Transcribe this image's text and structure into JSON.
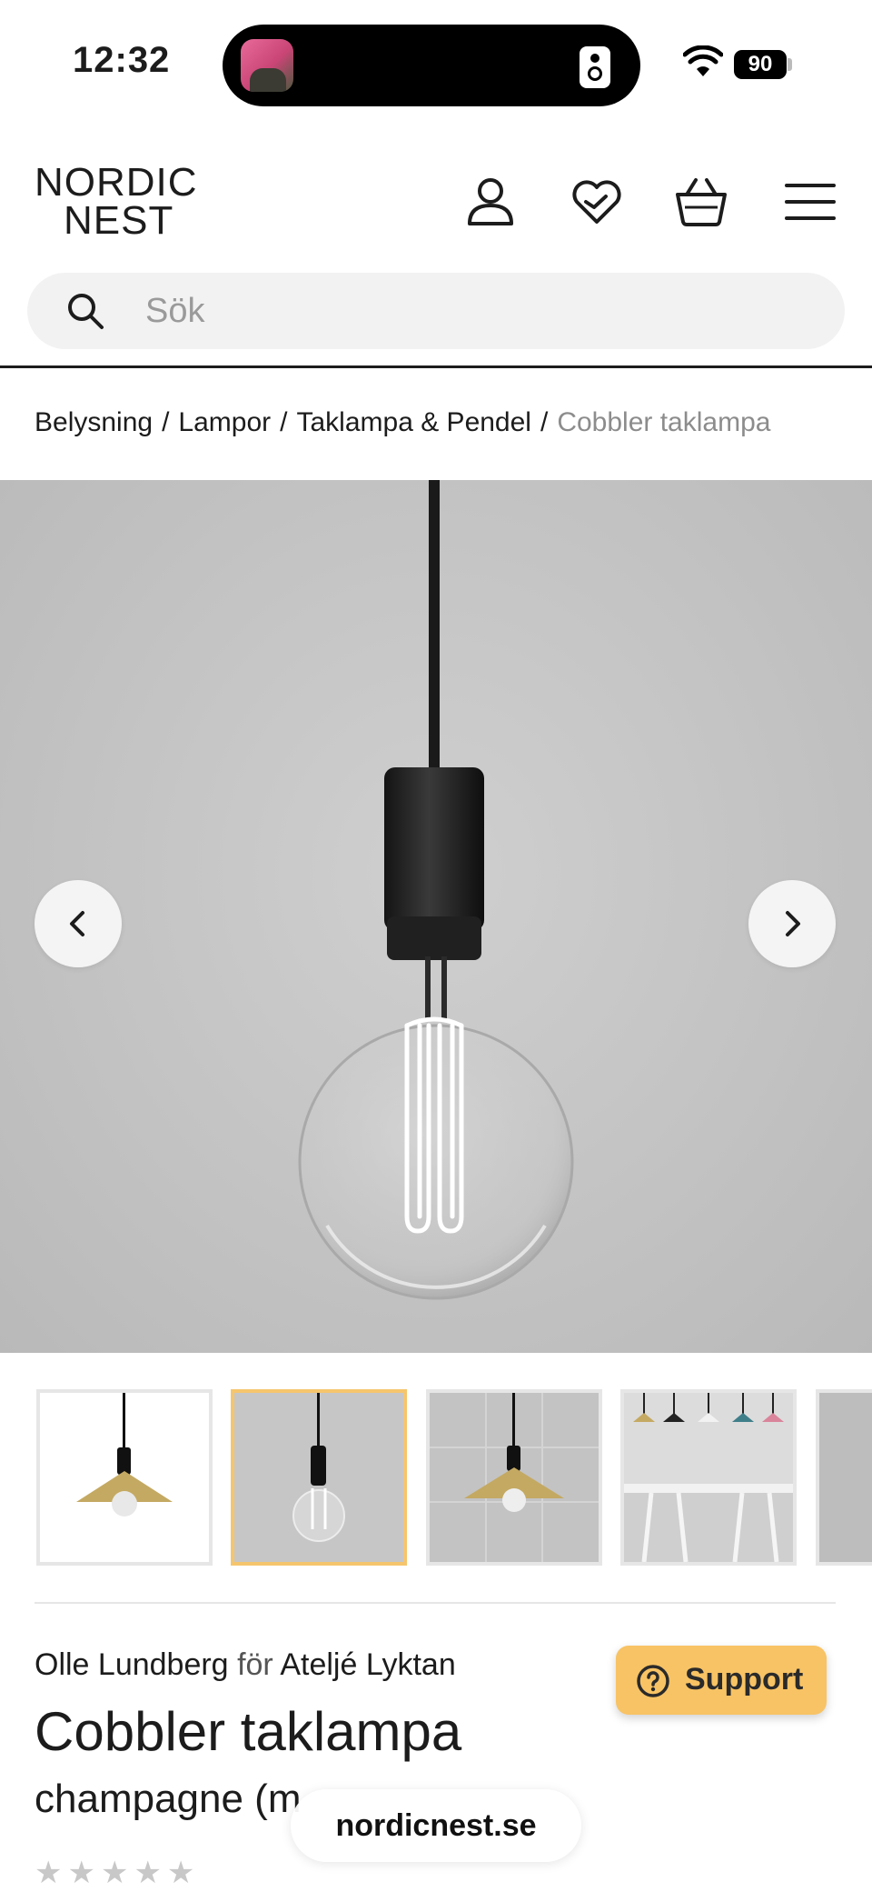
{
  "status_bar": {
    "time": "12:32",
    "battery": "90"
  },
  "header": {
    "logo_line1": "NORDIC",
    "logo_line2": "NEST",
    "icons": [
      "account-icon",
      "heart-icon",
      "basket-icon",
      "menu-icon"
    ],
    "search_placeholder": "Sök"
  },
  "breadcrumb": {
    "items": [
      "Belysning",
      "Lampor",
      "Taklampa & Pendel"
    ],
    "current": "Cobbler taklampa",
    "separator": "/"
  },
  "gallery": {
    "selected_index": 1,
    "thumbnail_count": 5
  },
  "product": {
    "designer": "Olle Lundberg",
    "for_word": "för",
    "brand": "Ateljé Lyktan",
    "title": "Cobbler taklampa",
    "variant": "champagne (m",
    "rating_stars": "★★★★★"
  },
  "support": {
    "label": "Support"
  },
  "browser": {
    "url": "nordicnest.se"
  },
  "colors": {
    "accent": "#f8c364",
    "thumb_selected_border": "#f5c56d",
    "text": "#1c1c1c",
    "muted": "#8c8c8c"
  }
}
